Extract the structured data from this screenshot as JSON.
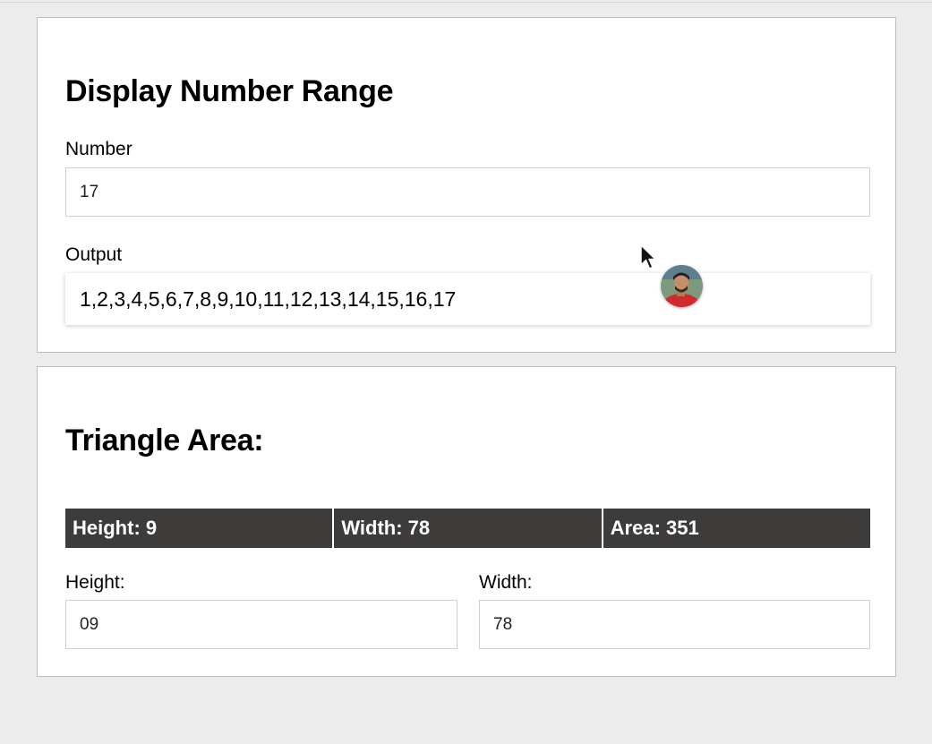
{
  "range_card": {
    "title": "Display Number Range",
    "number_label": "Number",
    "number_value": "17",
    "output_label": "Output",
    "output_value": "1,2,3,4,5,6,7,8,9,10,11,12,13,14,15,16,17"
  },
  "triangle_card": {
    "title": "Triangle Area:",
    "stats": [
      {
        "text": "Height: 9"
      },
      {
        "text": "Width: 78"
      },
      {
        "text": "Area: 351"
      }
    ],
    "height_label": "Height:",
    "height_value": "09",
    "width_label": "Width:",
    "width_value": "78"
  },
  "overlay": {
    "cursor_icon": "mouse-pointer-icon",
    "avatar_icon": "user-avatar"
  },
  "colors": {
    "page_background": "#ececec",
    "card_background": "#ffffff",
    "card_border": "#bdbdbd",
    "stat_background": "#3e3b3b",
    "stat_text": "#ffffff"
  }
}
